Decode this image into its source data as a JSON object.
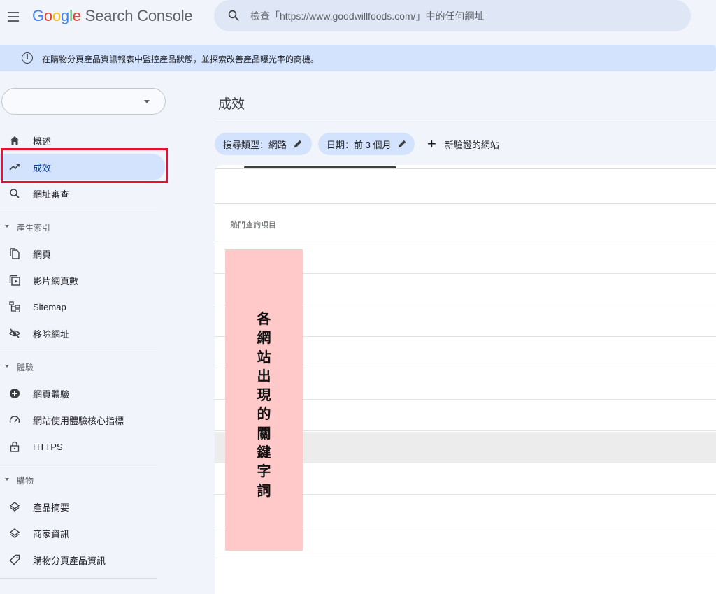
{
  "app": {
    "logo_letters": [
      "G",
      "o",
      "o",
      "g",
      "l",
      "e"
    ],
    "product_name": "Search Console"
  },
  "search": {
    "placeholder": "檢查「https://www.goodwillfoods.com/」中的任何網址",
    "icon": "search-icon"
  },
  "banner": {
    "text": "在購物分頁產品資訊報表中監控產品狀態，並探索改善產品曝光率的商機。",
    "icon": "info-icon"
  },
  "property_selector": {
    "value": ""
  },
  "sidebar": {
    "top_items": [
      {
        "label": "概述",
        "icon": "home-icon"
      },
      {
        "label": "成效",
        "icon": "trending-up-icon",
        "active": true
      },
      {
        "label": "網址審查",
        "icon": "search-icon"
      }
    ],
    "sections": [
      {
        "title": "產生索引",
        "items": [
          {
            "label": "網頁",
            "icon": "pages-icon"
          },
          {
            "label": "影片網頁數",
            "icon": "video-pages-icon"
          },
          {
            "label": "Sitemap",
            "icon": "sitemap-icon"
          },
          {
            "label": "移除網址",
            "icon": "visibility-off-icon"
          }
        ]
      },
      {
        "title": "體驗",
        "items": [
          {
            "label": "網頁體驗",
            "icon": "page-experience-icon"
          },
          {
            "label": "網站使用體驗核心指標",
            "icon": "speed-gauge-icon"
          },
          {
            "label": "HTTPS",
            "icon": "lock-icon"
          }
        ]
      },
      {
        "title": "購物",
        "items": [
          {
            "label": "產品摘要",
            "icon": "layers-icon"
          },
          {
            "label": "商家資訊",
            "icon": "layers-icon"
          },
          {
            "label": "購物分頁產品資訊",
            "icon": "tag-icon"
          }
        ]
      }
    ],
    "highlight_color": "#e8102c"
  },
  "main": {
    "title": "成效",
    "filters": [
      {
        "label": "搜尋類型：網路",
        "icon": "pencil-icon"
      },
      {
        "label": "日期：前 3 個月",
        "icon": "pencil-icon"
      }
    ],
    "add_site_label": "新驗證的網站",
    "table_header": "熱門查詢項目"
  },
  "annotation": {
    "text": "各網站出現的關鍵字詞",
    "background": "#ffc9c9"
  }
}
